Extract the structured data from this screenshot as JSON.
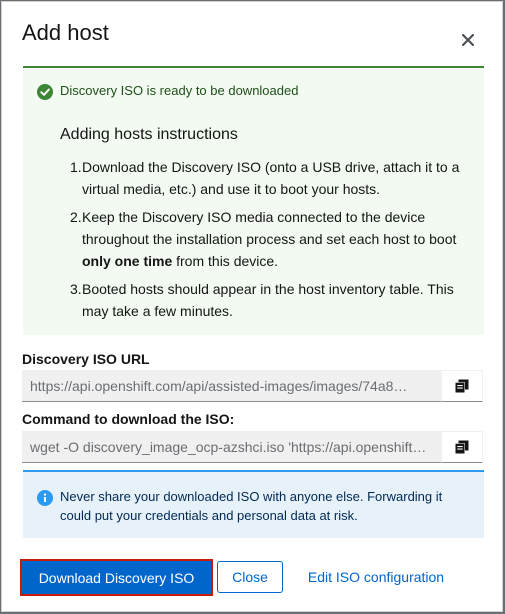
{
  "modal": {
    "title": "Add host",
    "close_icon": "close-icon"
  },
  "success_alert": {
    "icon": "check-circle-icon",
    "title": "Discovery ISO is ready to be downloaded",
    "color": "#3e8635"
  },
  "instructions": {
    "title": "Adding hosts instructions",
    "steps": [
      {
        "num": "1.",
        "text": "Download the Discovery ISO (onto a USB drive, attach it to a virtual media, etc.) and use it to boot your hosts."
      },
      {
        "num": "2.",
        "text_before": "Keep the Discovery ISO media connected to the device throughout the installation process and set each host to boot ",
        "text_bold": "only one time",
        "text_after": " from this device."
      },
      {
        "num": "3.",
        "text": "Booted hosts should appear in the host inventory table. This may take a few minutes."
      }
    ]
  },
  "iso_url": {
    "label": "Discovery ISO URL",
    "value": "https://api.openshift.com/api/assisted-images/images/74a8…",
    "copy_icon": "copy-icon"
  },
  "iso_command": {
    "label": "Command to download the ISO:",
    "value": "wget -O discovery_image_ocp-azshci.iso 'https://api.openshift…",
    "copy_icon": "copy-icon"
  },
  "info_alert": {
    "icon": "info-circle-icon",
    "text": "Never share your downloaded ISO with anyone else. Forwarding it could put your credentials and personal data at risk.",
    "color": "#2b9af3"
  },
  "footer": {
    "download_label": "Download Discovery ISO",
    "close_label": "Close",
    "edit_label": "Edit ISO configuration"
  },
  "colors": {
    "primary": "#0066cc",
    "highlight": "#c9190b"
  }
}
